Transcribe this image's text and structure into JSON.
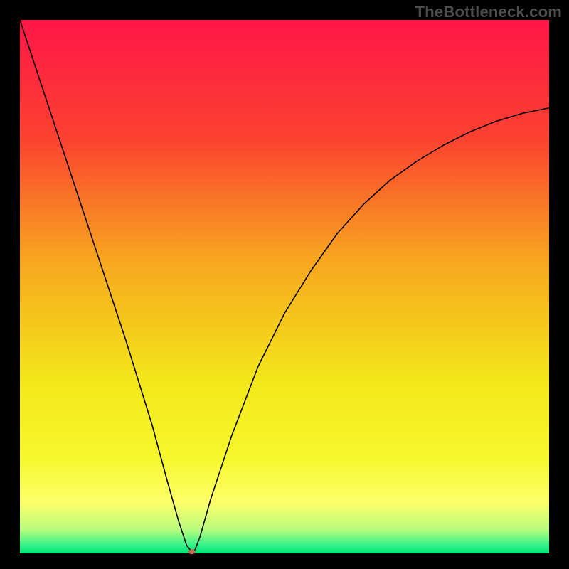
{
  "watermark": "TheBottleneck.com",
  "chart_data": {
    "type": "line",
    "title": "",
    "xlabel": "",
    "ylabel": "",
    "xlim": [
      0,
      100
    ],
    "ylim": [
      0,
      100
    ],
    "plot_background": {
      "gradient_stops": [
        {
          "offset": 0.0,
          "color": "#ff1648"
        },
        {
          "offset": 0.22,
          "color": "#fb4130"
        },
        {
          "offset": 0.45,
          "color": "#f7a61e"
        },
        {
          "offset": 0.68,
          "color": "#f3e81a"
        },
        {
          "offset": 0.82,
          "color": "#f6f72c"
        },
        {
          "offset": 0.905,
          "color": "#fdff69"
        },
        {
          "offset": 0.955,
          "color": "#b9fc7d"
        },
        {
          "offset": 0.985,
          "color": "#33f38a"
        },
        {
          "offset": 1.0,
          "color": "#00e276"
        }
      ]
    },
    "series": [
      {
        "name": "bottleneck-curve",
        "stroke": "#000000",
        "stroke_width": 1.6,
        "x": [
          0,
          5,
          10,
          15,
          20,
          25,
          28,
          30,
          31.5,
          32.5,
          33,
          34,
          36,
          40,
          45,
          50,
          55,
          60,
          65,
          70,
          75,
          80,
          85,
          90,
          95,
          100
        ],
        "values": [
          100,
          85,
          70,
          55,
          40,
          24,
          13,
          6,
          1.5,
          0.3,
          0.5,
          3,
          10,
          22,
          35,
          45,
          53,
          60,
          65.5,
          70,
          73.5,
          76.5,
          79,
          81,
          82.5,
          83.5
        ]
      }
    ],
    "marker": {
      "x": 32.5,
      "y": 0.3,
      "rx": 5,
      "ry": 3.5,
      "color": "#cd6a55"
    },
    "frame": {
      "outer_size": 800,
      "inner_margin_x": 28,
      "inner_margin_top": 28,
      "inner_margin_bottom": 22
    }
  }
}
